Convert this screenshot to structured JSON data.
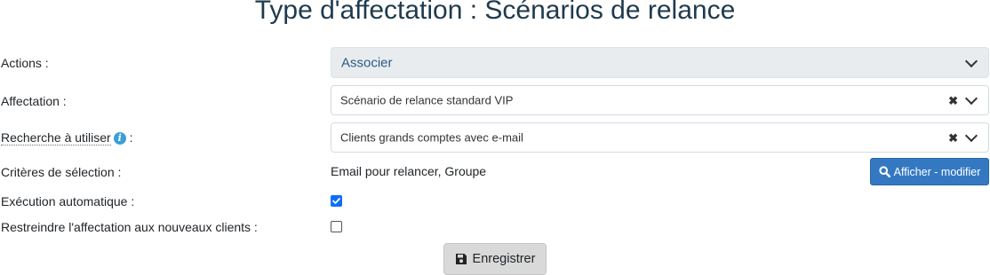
{
  "title": "Type d'affectation : Scénarios de relance",
  "form": {
    "actions": {
      "label": "Actions :",
      "value": "Associer"
    },
    "affectation": {
      "label": "Affectation :",
      "value": "Scénario de relance standard VIP",
      "clear": "✖"
    },
    "recherche": {
      "label": "Recherche à utiliser",
      "suffix": ":",
      "info": "i",
      "value": "Clients grands comptes avec e-mail",
      "clear": "✖"
    },
    "criteres": {
      "label": "Critères de sélection :",
      "value": "Email pour relancer, Groupe",
      "button": "Afficher - modifier"
    },
    "execution": {
      "label": "Exécution automatique :",
      "checked": true
    },
    "restreindre": {
      "label": "Restreindre l'affectation aux nouveaux clients :",
      "checked": false
    }
  },
  "save_button": "Enregistrer",
  "icons": {
    "search": "search-icon",
    "save": "floppy-disk-icon",
    "info": "info-icon",
    "chevron": "chevron-down-icon",
    "clear": "clear-icon",
    "check": "checkmark-icon"
  },
  "colors": {
    "primary": "#3478c2",
    "checkbox": "#0d6efd",
    "title": "#1f3a4d",
    "info": "#3a9fd6"
  }
}
